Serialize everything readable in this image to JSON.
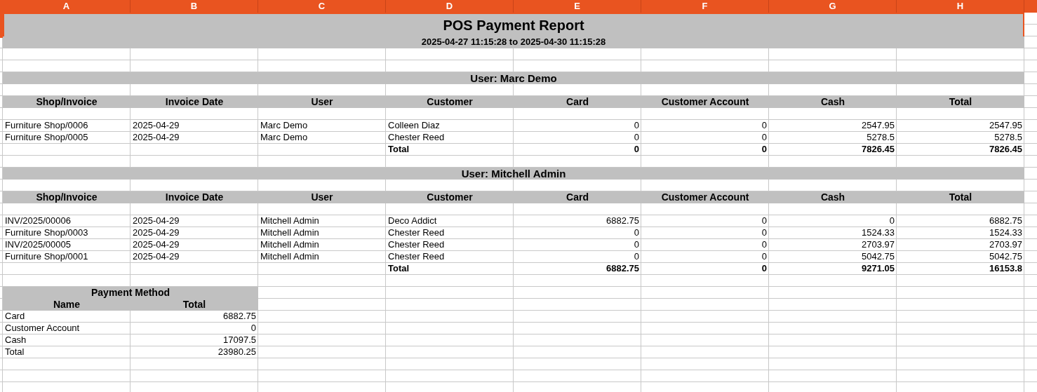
{
  "columns": [
    "A",
    "B",
    "C",
    "D",
    "E",
    "F",
    "G",
    "H"
  ],
  "title": {
    "text": "POS Payment Report",
    "selected": true
  },
  "subtitle": "2025-04-27 11:15:28 to 2025-04-30 11:15:28",
  "sections": [
    {
      "heading": "User: Marc Demo",
      "headers": [
        "Shop/Invoice",
        "Invoice Date",
        "User",
        "Customer",
        "Card",
        "Customer Account",
        "Cash",
        "Total"
      ],
      "rows": [
        {
          "shop_invoice": "Furniture Shop/0006",
          "invoice_date": "2025-04-29",
          "user": "Marc Demo",
          "customer": "Colleen Diaz",
          "card": "0",
          "customer_account": "0",
          "cash": "2547.95",
          "total": "2547.95"
        },
        {
          "shop_invoice": "Furniture Shop/0005",
          "invoice_date": "2025-04-29",
          "user": "Marc Demo",
          "customer": "Chester Reed",
          "card": "0",
          "customer_account": "0",
          "cash": "5278.5",
          "total": "5278.5"
        }
      ],
      "total": {
        "label": "Total",
        "card": "0",
        "customer_account": "0",
        "cash": "7826.45",
        "total": "7826.45"
      }
    },
    {
      "heading": "User: Mitchell Admin",
      "headers": [
        "Shop/Invoice",
        "Invoice Date",
        "User",
        "Customer",
        "Card",
        "Customer Account",
        "Cash",
        "Total"
      ],
      "rows": [
        {
          "shop_invoice": "INV/2025/00006",
          "invoice_date": "2025-04-29",
          "user": "Mitchell Admin",
          "customer": "Deco Addict",
          "card": "6882.75",
          "customer_account": "0",
          "cash": "0",
          "total": "6882.75"
        },
        {
          "shop_invoice": "Furniture Shop/0003",
          "invoice_date": "2025-04-29",
          "user": "Mitchell Admin",
          "customer": "Chester Reed",
          "card": "0",
          "customer_account": "0",
          "cash": "1524.33",
          "total": "1524.33"
        },
        {
          "shop_invoice": "INV/2025/00005",
          "invoice_date": "2025-04-29",
          "user": "Mitchell Admin",
          "customer": "Chester Reed",
          "card": "0",
          "customer_account": "0",
          "cash": "2703.97",
          "total": "2703.97"
        },
        {
          "shop_invoice": "Furniture Shop/0001",
          "invoice_date": "2025-04-29",
          "user": "Mitchell Admin",
          "customer": "Chester Reed",
          "card": "0",
          "customer_account": "0",
          "cash": "5042.75",
          "total": "5042.75"
        }
      ],
      "total": {
        "label": "Total",
        "card": "6882.75",
        "customer_account": "0",
        "cash": "9271.05",
        "total": "16153.8"
      }
    }
  ],
  "summary": {
    "title": "Payment Method",
    "headers": [
      "Name",
      "Total"
    ],
    "rows": [
      {
        "name": "Card",
        "total": "6882.75"
      },
      {
        "name": "Customer Account",
        "total": "0"
      },
      {
        "name": "Cash",
        "total": "17097.5"
      },
      {
        "name": "Total",
        "total": "23980.25"
      }
    ]
  }
}
